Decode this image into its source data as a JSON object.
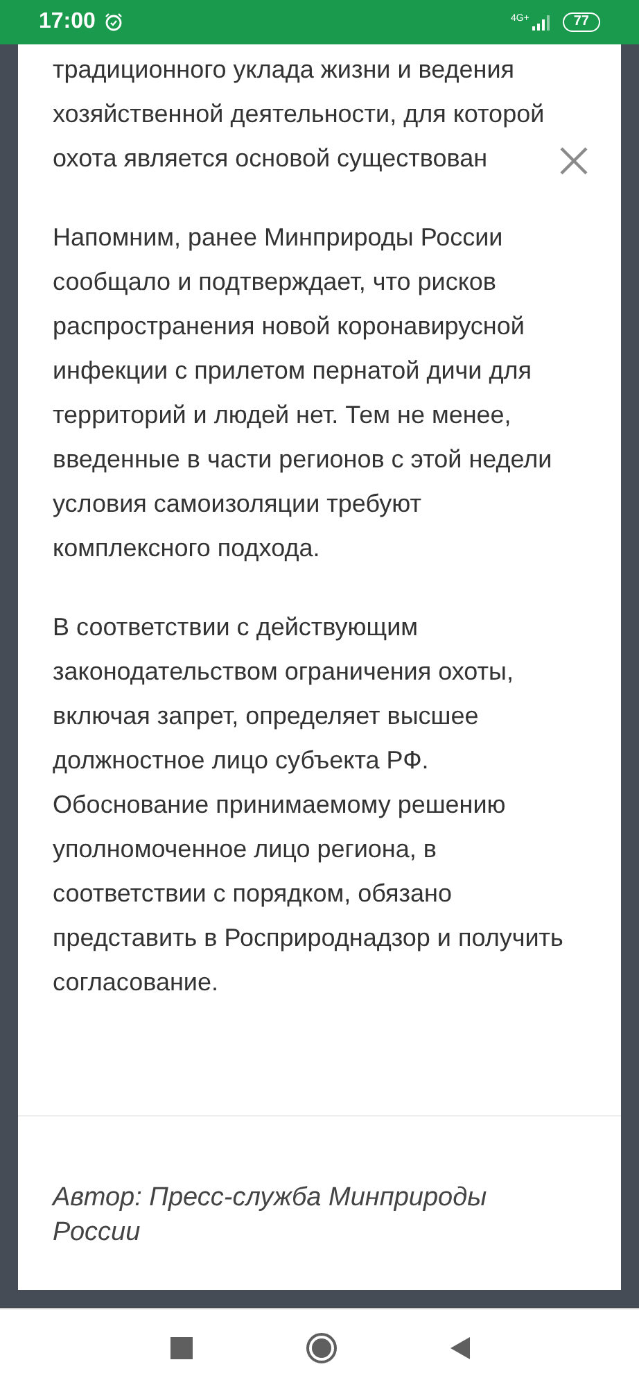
{
  "status_bar": {
    "time": "17:00",
    "network": "4G+",
    "battery": "77"
  },
  "article": {
    "paragraphs": [
      "традиционного уклада жизни и ведения хозяйственной деятельности, для которой охота является основой существован",
      "Напомним, ранее Минприроды России сообщало и подтверждает, что рисков распространения новой коронавирусной инфекции с прилетом пернатой дичи для территорий и людей нет. Тем не менее, введенные в части регионов с этой недели условия самоизоляции требуют комплексного подхода.",
      "В соответствии с действующим законодательством ограничения охоты, включая запрет, определяет высшее должностное лицо субъекта РФ. Обоснование принимаемому решению уполномоченное лицо региона, в соответствии с порядком, обязано представить в Росприроднадзор и получить согласование."
    ],
    "author": "Автор: Пресс-служба Минприроды России"
  }
}
